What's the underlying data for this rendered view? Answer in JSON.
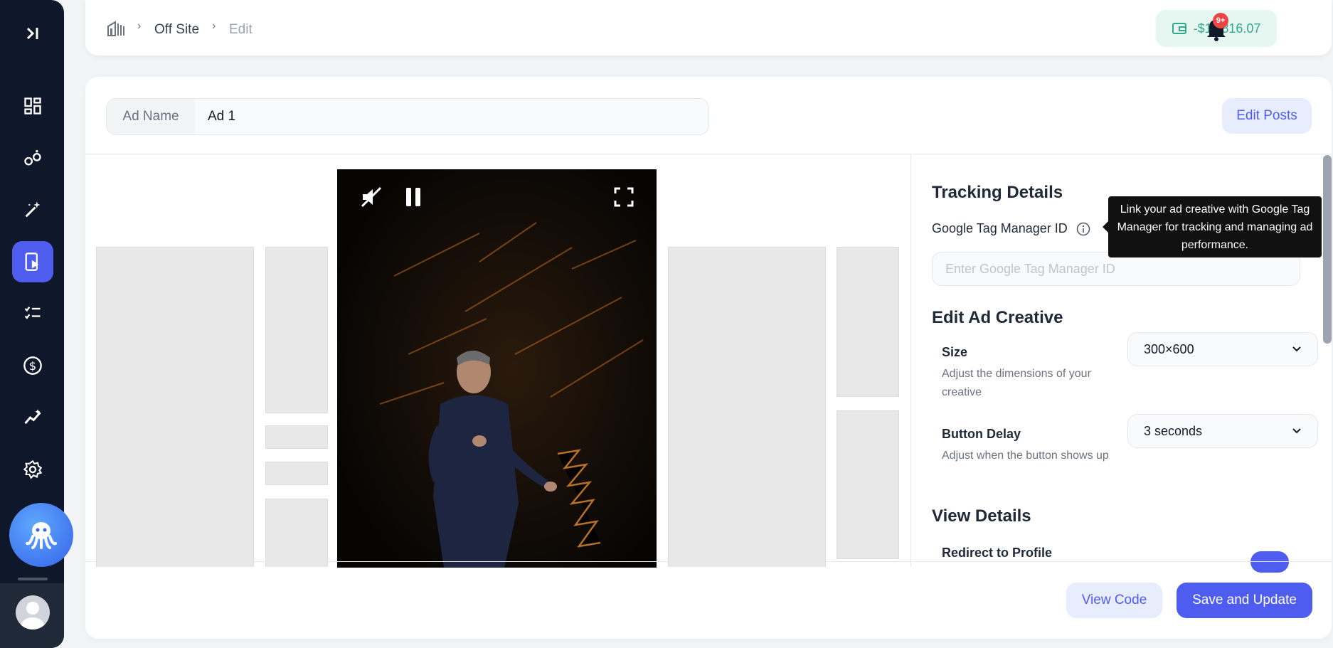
{
  "breadcrumb": {
    "home_icon": "building-icon",
    "items": [
      "Off Site",
      "Edit"
    ]
  },
  "header": {
    "balance": "-$11,816.07",
    "notification_badge": "9+"
  },
  "sidebar": {
    "items": [
      {
        "icon": "dashboard-icon"
      },
      {
        "icon": "network-icon"
      },
      {
        "icon": "magic-wand-icon"
      },
      {
        "icon": "ad-play-icon",
        "active": true
      },
      {
        "icon": "checklist-icon"
      },
      {
        "icon": "dollar-icon"
      },
      {
        "icon": "analytics-icon"
      },
      {
        "icon": "gear-icon"
      }
    ]
  },
  "ad": {
    "name_label": "Ad Name",
    "name_value": "Ad 1",
    "edit_posts_label": "Edit Posts"
  },
  "tracking": {
    "title": "Tracking Details",
    "gtm_label": "Google Tag Manager ID",
    "gtm_placeholder": "Enter Google Tag Manager ID",
    "tooltip": "Link your ad creative with Google Tag Manager for tracking and managing ad performance."
  },
  "creative": {
    "title": "Edit Ad Creative",
    "size_label": "Size",
    "size_desc": "Adjust the dimensions of your creative",
    "size_value": "300×600",
    "delay_label": "Button Delay",
    "delay_desc": "Adjust when the button shows up",
    "delay_value": "3 seconds"
  },
  "view": {
    "title": "View Details",
    "redirect_label": "Redirect to Profile",
    "redirect_on": true
  },
  "footer": {
    "view_code_label": "View Code",
    "save_label": "Save and Update"
  },
  "colors": {
    "accent": "#4f5cf0",
    "balance": "#2fa98a",
    "sidebar": "#0f172a"
  }
}
